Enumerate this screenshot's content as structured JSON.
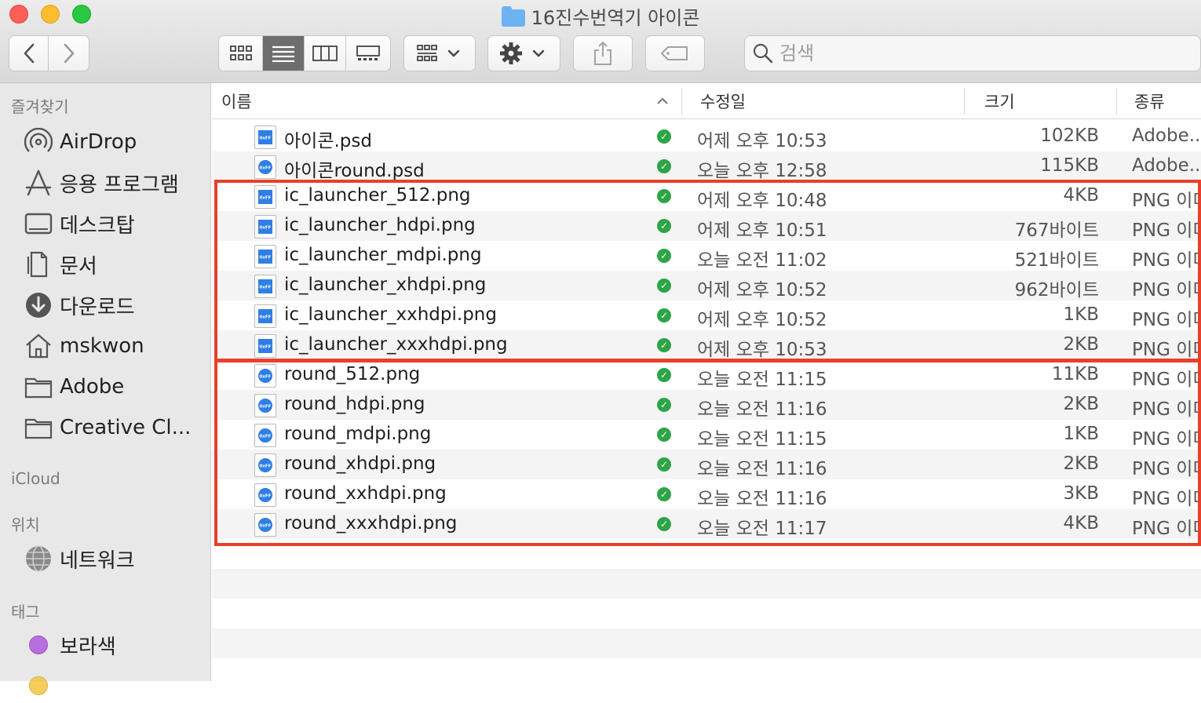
{
  "window": {
    "title": "16진수번역기 아이콘",
    "search_placeholder": "검색"
  },
  "toolbar": {
    "back_icon": "chevron-left-icon",
    "forward_icon": "chevron-right-icon",
    "view_modes": [
      "icon-view-icon",
      "list-view-icon",
      "column-view-icon",
      "gallery-view-icon"
    ],
    "active_view": "list",
    "group_icon": "group-icon",
    "action_icon": "gear-icon",
    "share_icon": "share-icon",
    "tag_icon": "tag-icon"
  },
  "sidebar": {
    "favorites_label": "즐겨찾기",
    "favorites": [
      {
        "label": "AirDrop",
        "icon": "airdrop-icon"
      },
      {
        "label": "응용 프로그램",
        "icon": "applications-icon"
      },
      {
        "label": "데스크탑",
        "icon": "desktop-icon"
      },
      {
        "label": "문서",
        "icon": "document-icon"
      },
      {
        "label": "다운로드",
        "icon": "download-icon"
      },
      {
        "label": "mskwon",
        "icon": "home-icon"
      },
      {
        "label": "Adobe",
        "icon": "folder-icon"
      },
      {
        "label": "Creative Cl...",
        "icon": "folder-icon"
      }
    ],
    "icloud_label": "iCloud",
    "locations_label": "위치",
    "locations": [
      {
        "label": "네트워크",
        "icon": "network-icon"
      }
    ],
    "tags_label": "태그",
    "tags": [
      {
        "label": "보라색",
        "color": "#b66fdc"
      }
    ]
  },
  "columns": {
    "name": "이름",
    "modified": "수정일",
    "size": "크기",
    "kind": "종류"
  },
  "files": [
    {
      "name": "아이콘.psd",
      "date": "어제 오후 10:53",
      "size": "102KB",
      "kind": "Adobe...",
      "round": false
    },
    {
      "name": "아이콘round.psd",
      "date": "오늘 오후 12:58",
      "size": "115KB",
      "kind": "Adobe...",
      "round": true
    },
    {
      "name": "ic_launcher_512.png",
      "date": "어제 오후 10:48",
      "size": "4KB",
      "kind": "PNG 이미",
      "round": false
    },
    {
      "name": "ic_launcher_hdpi.png",
      "date": "어제 오후 10:51",
      "size": "767바이트",
      "kind": "PNG 이미",
      "round": false
    },
    {
      "name": "ic_launcher_mdpi.png",
      "date": "오늘 오전 11:02",
      "size": "521바이트",
      "kind": "PNG 이미",
      "round": false
    },
    {
      "name": "ic_launcher_xhdpi.png",
      "date": "어제 오후 10:52",
      "size": "962바이트",
      "kind": "PNG 이미",
      "round": false
    },
    {
      "name": "ic_launcher_xxhdpi.png",
      "date": "어제 오후 10:52",
      "size": "1KB",
      "kind": "PNG 이미",
      "round": false
    },
    {
      "name": "ic_launcher_xxxhdpi.png",
      "date": "어제 오후 10:53",
      "size": "2KB",
      "kind": "PNG 이미",
      "round": false
    },
    {
      "name": "round_512.png",
      "date": "오늘 오전 11:15",
      "size": "11KB",
      "kind": "PNG 이미",
      "round": true
    },
    {
      "name": "round_hdpi.png",
      "date": "오늘 오전 11:16",
      "size": "2KB",
      "kind": "PNG 이미",
      "round": true
    },
    {
      "name": "round_mdpi.png",
      "date": "오늘 오전 11:15",
      "size": "1KB",
      "kind": "PNG 이미",
      "round": true
    },
    {
      "name": "round_xhdpi.png",
      "date": "오늘 오전 11:16",
      "size": "2KB",
      "kind": "PNG 이미",
      "round": true
    },
    {
      "name": "round_xxhdpi.png",
      "date": "오늘 오전 11:16",
      "size": "3KB",
      "kind": "PNG 이미",
      "round": true
    },
    {
      "name": "round_xxxhdpi.png",
      "date": "오늘 오전 11:17",
      "size": "4KB",
      "kind": "PNG 이미",
      "round": true
    }
  ],
  "thumb_text": "0xFF",
  "colors": {
    "highlight": "#e8402a",
    "synced": "#2da547",
    "file_icon_blue": "#2f7ee6"
  }
}
